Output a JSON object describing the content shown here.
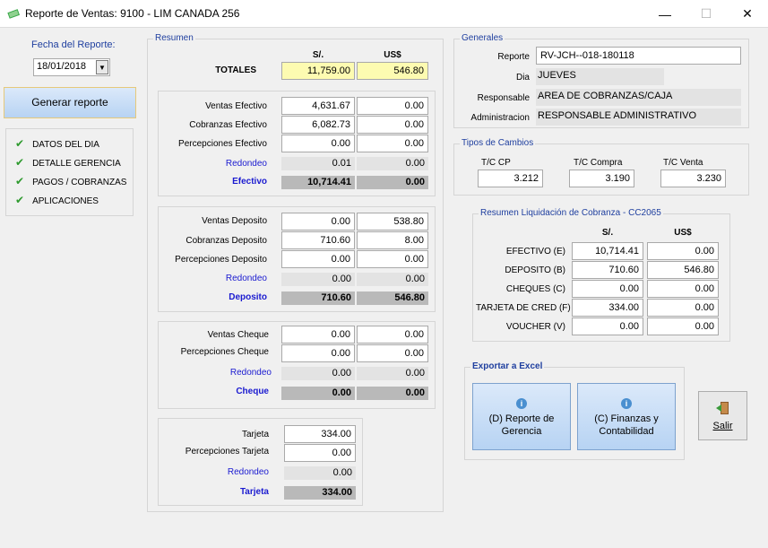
{
  "window": {
    "title": "Reporte de Ventas: 9100 - LIM CANADA 256",
    "minimize": "—",
    "maximize": "☐",
    "close": "✕",
    "icon_color": "#3aa84a"
  },
  "left": {
    "fecha_label": "Fecha del Reporte:",
    "fecha_value": "18/01/2018",
    "generar_label": "Generar reporte",
    "checklist": [
      "DATOS DEL DIA",
      "DETALLE GERENCIA",
      "PAGOS / COBRANZAS",
      "APLICACIONES"
    ]
  },
  "resumen": {
    "title": "Resumen",
    "hdr_sol": "S/.",
    "hdr_usd": "US$",
    "totales_label": "TOTALES",
    "totales_sol": "11,759.00",
    "totales_usd": "546.80",
    "efectivo": {
      "rows": [
        {
          "label": "Ventas Efectivo",
          "sol": "4,631.67",
          "usd": "0.00"
        },
        {
          "label": "Cobranzas Efectivo",
          "sol": "6,082.73",
          "usd": "0.00"
        },
        {
          "label": "Percepciones Efectivo",
          "sol": "0.00",
          "usd": "0.00"
        }
      ],
      "redondeo_label": "Redondeo",
      "redondeo_sol": "0.01",
      "redondeo_usd": "0.00",
      "total_label": "Efectivo",
      "total_sol": "10,714.41",
      "total_usd": "0.00"
    },
    "deposito": {
      "rows": [
        {
          "label": "Ventas Deposito",
          "sol": "0.00",
          "usd": "538.80"
        },
        {
          "label": "Cobranzas Deposito",
          "sol": "710.60",
          "usd": "8.00"
        },
        {
          "label": "Percepciones Deposito",
          "sol": "0.00",
          "usd": "0.00"
        }
      ],
      "redondeo_label": "Redondeo",
      "redondeo_sol": "0.00",
      "redondeo_usd": "0.00",
      "total_label": "Deposito",
      "total_sol": "710.60",
      "total_usd": "546.80"
    },
    "cheque": {
      "rows": [
        {
          "label": "Ventas Cheque",
          "sol": "0.00",
          "usd": "0.00"
        },
        {
          "label": "Percepciones Cheque",
          "sol": "0.00",
          "usd": "0.00"
        }
      ],
      "redondeo_label": "Redondeo",
      "redondeo_sol": "0.00",
      "redondeo_usd": "0.00",
      "total_label": "Cheque",
      "total_sol": "0.00",
      "total_usd": "0.00"
    },
    "tarjeta": {
      "rows": [
        {
          "label": "Tarjeta",
          "sol": "334.00"
        },
        {
          "label": "Percepciones Tarjeta",
          "sol": "0.00"
        }
      ],
      "redondeo_label": "Redondeo",
      "redondeo_sol": "0.00",
      "total_label": "Tarjeta",
      "total_sol": "334.00"
    }
  },
  "generales": {
    "title": "Generales",
    "reporte_label": "Reporte",
    "reporte_value": "RV-JCH--018-180118",
    "dia_label": "Dia",
    "dia_value": "JUEVES",
    "responsable_label": "Responsable",
    "responsable_value": "AREA DE COBRANZAS/CAJA",
    "administracion_label": "Administracion",
    "administracion_value": "RESPONSABLE ADMINISTRATIVO"
  },
  "cambios": {
    "title": "Tipos de Cambios",
    "cp_label": "T/C CP",
    "cp_value": "3.212",
    "compra_label": "T/C Compra",
    "compra_value": "3.190",
    "venta_label": "T/C Venta",
    "venta_value": "3.230"
  },
  "liquidacion": {
    "title": "Resumen Liquidación de Cobranza - CC2065",
    "hdr_sol": "S/.",
    "hdr_usd": "US$",
    "rows": [
      {
        "label": "EFECTIVO (E)",
        "sol": "10,714.41",
        "usd": "0.00"
      },
      {
        "label": "DEPOSITO (B)",
        "sol": "710.60",
        "usd": "546.80"
      },
      {
        "label": "CHEQUES (C)",
        "sol": "0.00",
        "usd": "0.00"
      },
      {
        "label": "TARJETA DE CRED (F)",
        "sol": "334.00",
        "usd": "0.00"
      },
      {
        "label": "VOUCHER (V)",
        "sol": "0.00",
        "usd": "0.00"
      }
    ]
  },
  "exportar": {
    "title": "Exportar a Excel",
    "gerencia_label": "(D) Reporte de Gerencia",
    "finanzas_label": "(C) Finanzas y Contabilidad",
    "info_glyph": "i"
  },
  "salir_label": "Salir"
}
